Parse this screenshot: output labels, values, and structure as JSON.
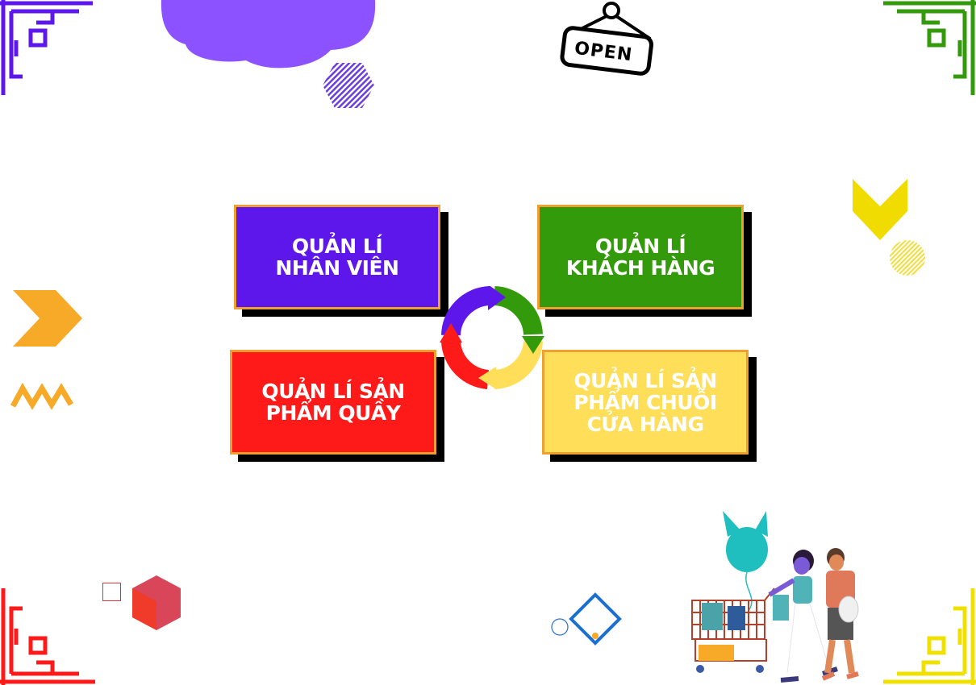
{
  "menu": {
    "items": [
      {
        "label": "QUẢN LÍ\nNHÂN VIÊN",
        "color": "#5e17eb"
      },
      {
        "label": "QUẢN LÍ\nKHÁCH HÀNG",
        "color": "#339a0b"
      },
      {
        "label": "QUẢN LÍ SẢN\nPHẨM QUẦY",
        "color": "#ff1a1a"
      },
      {
        "label": "QUẢN LÍ SẢN\nPHẨM CHUỖI\nCỬA HÀNG",
        "color": "#ffde59"
      }
    ]
  },
  "sign": {
    "text": "OPEN"
  },
  "icons": {
    "cycle": "cycle-arrows-icon",
    "cloud": "cloud-icon",
    "hexagon": "hexagon-icon",
    "chevron_down": "chevron-down-icon",
    "chevron_right": "chevron-right-icon",
    "zigzag": "zigzag-icon",
    "cube": "cube-icon",
    "diamond": "diamond-icon",
    "shoppers": "shoppers-illustration"
  },
  "colors": {
    "purple": "#5e17eb",
    "green": "#339a0b",
    "red": "#ff1a1a",
    "yellow": "#ffde59",
    "orange": "#f7a928",
    "border": "#f0a030"
  }
}
